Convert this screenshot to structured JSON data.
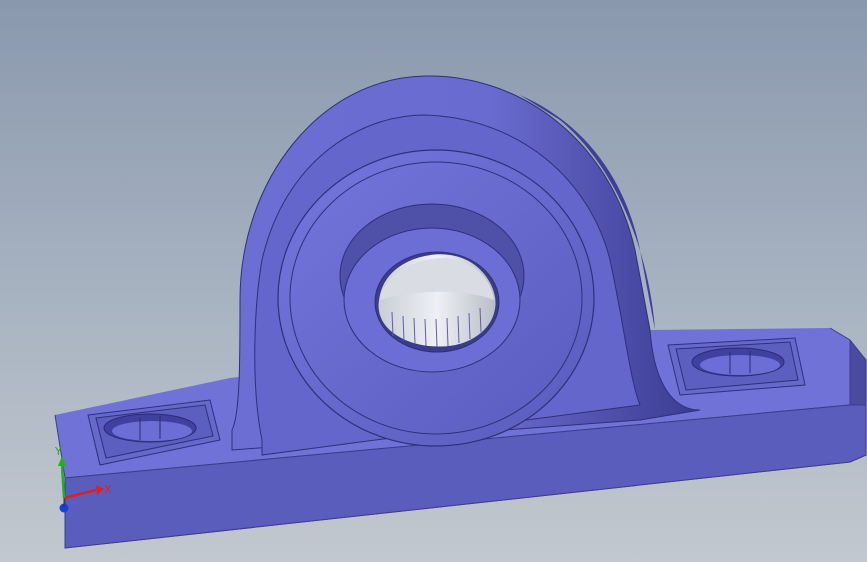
{
  "viewport": {
    "background_top": "#8a98ae",
    "background_bottom": "#c2c8cf",
    "model_color": "#6465c6",
    "model_shade": "#4e4fa8",
    "model_light": "#7c7ee0",
    "bearing_color": "#d7dbe2"
  },
  "triad": {
    "x_label": "X",
    "y_label": "Y",
    "x_color": "#e02020",
    "y_color": "#22b022",
    "z_color": "#1a3fd8"
  }
}
